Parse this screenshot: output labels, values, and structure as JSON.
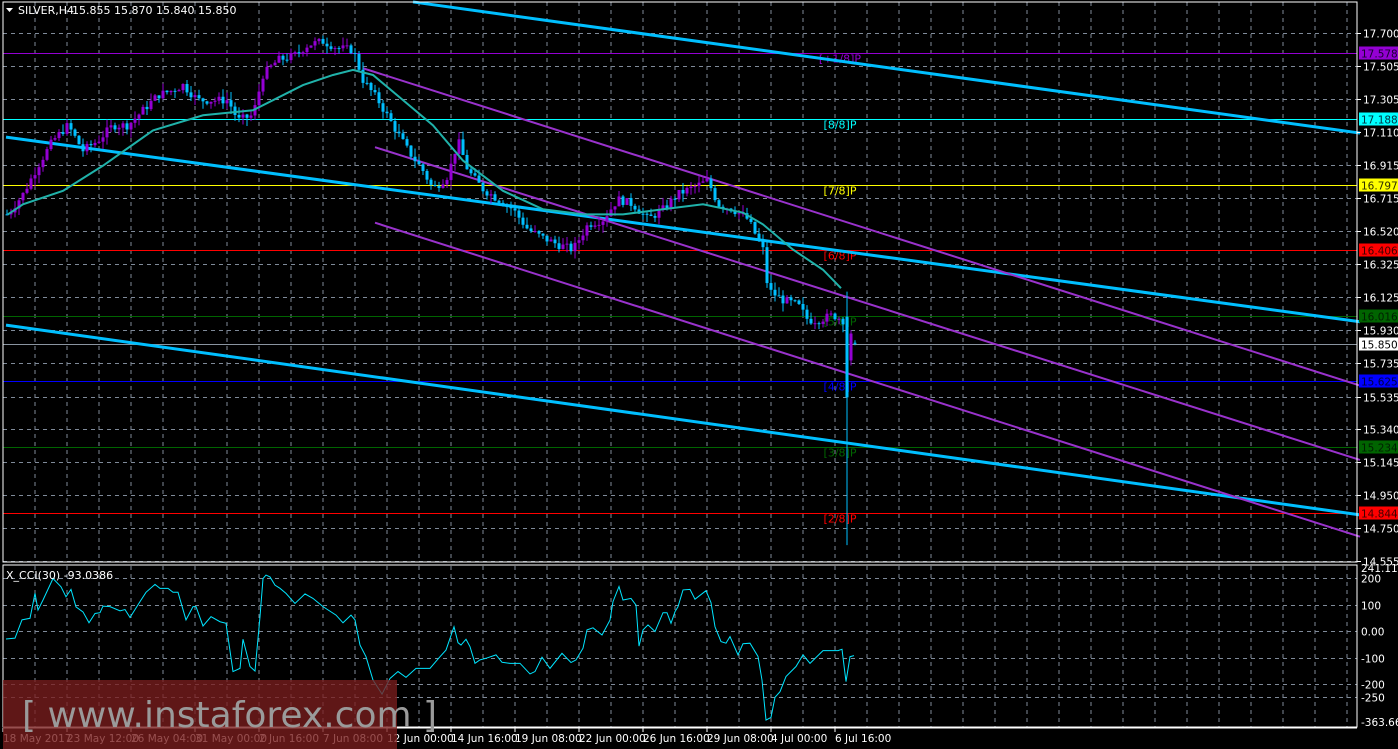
{
  "header": {
    "menu_icon": "triangle-down-icon",
    "symbol": "SILVER,H4",
    "ohlc": "15.855 15.870 15.840 15.850"
  },
  "indicator": {
    "label": "X_CCI(30) -93.0386"
  },
  "watermark": "[ www.instaforex.com ]",
  "colors": {
    "background": "#000000",
    "grid": "#7f8a99",
    "bull": "#9400D3",
    "bear": "#00BFFF",
    "ma": "#20B2AA",
    "trend": "#00BFFF",
    "channel": "#9932CC",
    "cci": "#00E5FF"
  },
  "chart_data": [
    {
      "type": "candlestick",
      "title": "SILVER,H4",
      "yaxis_ticks": [
        "17.700",
        "17.505",
        "17.305",
        "17.110",
        "16.915",
        "16.715",
        "16.520",
        "16.325",
        "16.125",
        "15.930",
        "15.735",
        "15.535",
        "15.340",
        "15.145",
        "14.950",
        "14.750",
        "14.555"
      ],
      "ylim": [
        14.555,
        17.7
      ],
      "xaxis_labels": [
        "18 May 2017",
        "23 May 12:00",
        "26 May 04:00",
        "31 May 00:00",
        "2 Jun 16:00",
        "7 Jun 08:00",
        "12 Jun 00:00",
        "14 Jun 16:00",
        "19 Jun 08:00",
        "22 Jun 00:00",
        "26 Jun 16:00",
        "29 Jun 08:00",
        "4 Jul 00:00",
        "6 Jul 16:00"
      ],
      "bars_per_label": 16,
      "close_path": [
        [
          1.25,
          16.62
        ],
        [
          5,
          16.74
        ],
        [
          8.75,
          16.91
        ],
        [
          12.5,
          17.06
        ],
        [
          16.25,
          17.15
        ],
        [
          20,
          17.0
        ],
        [
          23.75,
          17.06
        ],
        [
          27.5,
          17.15
        ],
        [
          31.25,
          17.15
        ],
        [
          35,
          17.24
        ],
        [
          38.75,
          17.33
        ],
        [
          42.5,
          17.36
        ],
        [
          45,
          17.39
        ],
        [
          48.75,
          17.3
        ],
        [
          52.5,
          17.3
        ],
        [
          56.25,
          17.3
        ],
        [
          58.75,
          17.18
        ],
        [
          62.5,
          17.21
        ],
        [
          65,
          17.45
        ],
        [
          68.75,
          17.54
        ],
        [
          72.5,
          17.56
        ],
        [
          76.25,
          17.63
        ],
        [
          80,
          17.65
        ],
        [
          83.75,
          17.61
        ],
        [
          87.5,
          17.6
        ],
        [
          90,
          17.42
        ],
        [
          93.75,
          17.3
        ],
        [
          97.5,
          17.15
        ],
        [
          101.25,
          17.0
        ],
        [
          105,
          16.88
        ],
        [
          107.5,
          16.77
        ],
        [
          111.25,
          16.85
        ],
        [
          113.75,
          17.06
        ],
        [
          116.25,
          16.88
        ],
        [
          120,
          16.77
        ],
        [
          123.75,
          16.71
        ],
        [
          127.5,
          16.65
        ],
        [
          131.25,
          16.53
        ],
        [
          135,
          16.48
        ],
        [
          138.75,
          16.44
        ],
        [
          142.5,
          16.41
        ],
        [
          146.25,
          16.56
        ],
        [
          150,
          16.59
        ],
        [
          153.75,
          16.71
        ],
        [
          157.5,
          16.68
        ],
        [
          161.25,
          16.59
        ],
        [
          165,
          16.65
        ],
        [
          168.75,
          16.74
        ],
        [
          172.5,
          16.78
        ],
        [
          176.25,
          16.82
        ],
        [
          178.75,
          16.68
        ],
        [
          182.5,
          16.65
        ],
        [
          186.25,
          16.59
        ],
        [
          190,
          16.41
        ],
        [
          191.25,
          16.17
        ],
        [
          195,
          16.11
        ],
        [
          198.75,
          16.08
        ],
        [
          201.25,
          15.99
        ],
        [
          203.75,
          15.99
        ],
        [
          207.5,
          16.02
        ],
        [
          210,
          15.99
        ]
      ],
      "last_candles": [
        {
          "bar": 211,
          "o": 16.01,
          "h": 16.16,
          "l": 14.65,
          "c": 15.53
        },
        {
          "bar": 212,
          "o": 15.75,
          "h": 15.93,
          "l": 15.72,
          "c": 15.91
        },
        {
          "bar": 213,
          "o": 15.855,
          "h": 15.87,
          "l": 15.84,
          "c": 15.85
        }
      ],
      "moving_average": [
        [
          1.25,
          16.62
        ],
        [
          5,
          16.68
        ],
        [
          15,
          16.76
        ],
        [
          25,
          16.91
        ],
        [
          37.5,
          17.12
        ],
        [
          50,
          17.21
        ],
        [
          62.5,
          17.24
        ],
        [
          75,
          17.39
        ],
        [
          82.5,
          17.45
        ],
        [
          87.5,
          17.48
        ],
        [
          92.5,
          17.45
        ],
        [
          100,
          17.3
        ],
        [
          107.5,
          17.15
        ],
        [
          115,
          16.94
        ],
        [
          125,
          16.76
        ],
        [
          135,
          16.65
        ],
        [
          145,
          16.62
        ],
        [
          155,
          16.62
        ],
        [
          165,
          16.65
        ],
        [
          175,
          16.68
        ],
        [
          185,
          16.63
        ],
        [
          190,
          16.56
        ],
        [
          197.5,
          16.41
        ],
        [
          205,
          16.29
        ],
        [
          209.5,
          16.18
        ]
      ],
      "trendlines": [
        {
          "kind": "trend",
          "from": [
            102.5,
            17.885
          ],
          "to": [
            339.25,
            17.104
          ]
        },
        {
          "kind": "trend",
          "from": [
            0.75,
            17.08
          ],
          "to": [
            339.25,
            15.98
          ]
        },
        {
          "kind": "trend",
          "from": [
            0.75,
            15.96
          ],
          "to": [
            339.25,
            14.83
          ]
        },
        {
          "kind": "channel",
          "from": [
            90,
            17.49
          ],
          "to": [
            339.25,
            15.6
          ]
        },
        {
          "kind": "channel",
          "from": [
            93,
            17.02
          ],
          "to": [
            339.25,
            15.157
          ]
        },
        {
          "kind": "channel",
          "from": [
            93,
            16.57
          ],
          "to": [
            339.25,
            14.7
          ]
        }
      ],
      "levels": [
        {
          "price": 17.578,
          "value": "17.578",
          "label": "[+1/8]P",
          "color": "#9400D3",
          "text": "#1a0030"
        },
        {
          "price": 17.188,
          "value": "17.188",
          "label": "[8/8]P",
          "color": "#00FFFF",
          "text": "#003040"
        },
        {
          "price": 16.797,
          "value": "16.797",
          "label": "[7/8]P",
          "color": "#FFFF00",
          "text": "#303000"
        },
        {
          "price": 16.406,
          "value": "16.406",
          "label": "[6/8]P",
          "color": "#FF0000",
          "text": "#400000"
        },
        {
          "price": 16.016,
          "value": "16.016",
          "label": "[5/8]P",
          "color": "#006400",
          "text": "#002000"
        },
        {
          "price": 15.625,
          "value": "15.625",
          "label": "[4/8]P",
          "color": "#0000FF",
          "text": "#000040"
        },
        {
          "price": 15.234,
          "value": "15.234",
          "label": "[3/8]P",
          "color": "#006400",
          "text": "#002000"
        },
        {
          "price": 14.844,
          "value": "14.844",
          "label": "[2/8]P",
          "color": "#FF0000",
          "text": "#400000"
        }
      ],
      "current_price": {
        "price": 15.85,
        "value": "15.850"
      }
    },
    {
      "type": "line",
      "title": "X_CCI(30)",
      "ylim": [
        -363.663,
        241.1164
      ],
      "yaxis_ticks": [
        "241.1164",
        "200",
        "100",
        "0.00",
        "-100",
        "-200",
        "-250",
        "-363.663"
      ],
      "ytick_values": [
        241.1164,
        200,
        100,
        0,
        -100,
        -200,
        -250,
        -363.663
      ],
      "series": [
        [
          0.75,
          -30
        ],
        [
          3,
          -27
        ],
        [
          4.75,
          42
        ],
        [
          6.75,
          48
        ],
        [
          8,
          142
        ],
        [
          8.75,
          79
        ],
        [
          10,
          117
        ],
        [
          12.5,
          198
        ],
        [
          14.5,
          167
        ],
        [
          15.75,
          129
        ],
        [
          17,
          157
        ],
        [
          18.25,
          91
        ],
        [
          20,
          72
        ],
        [
          21.5,
          31
        ],
        [
          23,
          66
        ],
        [
          24.25,
          69
        ],
        [
          25,
          94
        ],
        [
          26.75,
          92
        ],
        [
          29.25,
          76
        ],
        [
          30.5,
          81
        ],
        [
          31.75,
          51
        ],
        [
          34.25,
          111
        ],
        [
          35.75,
          146
        ],
        [
          38,
          176
        ],
        [
          39.25,
          161
        ],
        [
          41.25,
          161
        ],
        [
          42.5,
          146
        ],
        [
          43.75,
          146
        ],
        [
          45.75,
          42
        ],
        [
          47.5,
          92
        ],
        [
          48.25,
          92
        ],
        [
          50,
          19
        ],
        [
          52,
          54
        ],
        [
          54.25,
          35
        ],
        [
          55.75,
          29
        ],
        [
          57.5,
          -153
        ],
        [
          59.25,
          -141
        ],
        [
          60,
          -31
        ],
        [
          61.75,
          -134
        ],
        [
          63,
          -151
        ],
        [
          64.25,
          54
        ],
        [
          65,
          198
        ],
        [
          65.75,
          211
        ],
        [
          66.75,
          204
        ],
        [
          68,
          173
        ],
        [
          69.25,
          161
        ],
        [
          70.75,
          142
        ],
        [
          73,
          104
        ],
        [
          75.5,
          140
        ],
        [
          77.5,
          123
        ],
        [
          80,
          92
        ],
        [
          83.25,
          60
        ],
        [
          85,
          31
        ],
        [
          87,
          60
        ],
        [
          88,
          42
        ],
        [
          89.25,
          -53
        ],
        [
          90.75,
          -97
        ],
        [
          92.5,
          -185
        ],
        [
          94.75,
          -238
        ],
        [
          96.75,
          -179
        ],
        [
          98.75,
          -153
        ],
        [
          100.75,
          -175
        ],
        [
          103.25,
          -141
        ],
        [
          106.75,
          -141
        ],
        [
          109.25,
          -97
        ],
        [
          110.75,
          -72
        ],
        [
          112.75,
          16
        ],
        [
          113.75,
          -44
        ],
        [
          114.5,
          -53
        ],
        [
          115.75,
          -31
        ],
        [
          116.75,
          -59
        ],
        [
          118,
          -122
        ],
        [
          119.25,
          -109
        ],
        [
          120.75,
          -103
        ],
        [
          123.25,
          -90
        ],
        [
          124.75,
          -118
        ],
        [
          126.75,
          -122
        ],
        [
          129.25,
          -122
        ],
        [
          131.75,
          -162
        ],
        [
          133,
          -153
        ],
        [
          134.75,
          -99
        ],
        [
          136.75,
          -141
        ],
        [
          139.75,
          -84
        ],
        [
          142,
          -119
        ],
        [
          143.25,
          -109
        ],
        [
          145,
          -65
        ],
        [
          146,
          4
        ],
        [
          147.5,
          12
        ],
        [
          149.75,
          -15
        ],
        [
          151.75,
          41
        ],
        [
          152.5,
          111
        ],
        [
          154,
          168
        ],
        [
          155,
          117
        ],
        [
          157,
          123
        ],
        [
          158.25,
          98
        ],
        [
          159,
          -57
        ],
        [
          160,
          4
        ],
        [
          161.25,
          23
        ],
        [
          163,
          -2
        ],
        [
          165,
          69
        ],
        [
          166,
          69
        ],
        [
          167,
          29
        ],
        [
          168,
          73
        ],
        [
          168.75,
          92
        ],
        [
          170,
          155
        ],
        [
          171.75,
          157
        ],
        [
          173,
          120
        ],
        [
          175.75,
          152
        ],
        [
          177,
          107
        ],
        [
          178,
          16
        ],
        [
          179.5,
          -40
        ],
        [
          180.75,
          -46
        ],
        [
          181.75,
          -21
        ],
        [
          183.75,
          -90
        ],
        [
          185,
          -48
        ],
        [
          186.75,
          -46
        ],
        [
          188.75,
          -96
        ],
        [
          189.75,
          -185
        ],
        [
          190.75,
          -336
        ],
        [
          192,
          -326
        ],
        [
          193,
          -250
        ],
        [
          194.25,
          -229
        ],
        [
          195.75,
          -172
        ],
        [
          198.25,
          -134
        ],
        [
          200,
          -90
        ],
        [
          201.75,
          -122
        ],
        [
          205,
          -74
        ],
        [
          208.75,
          -74
        ],
        [
          209.75,
          -69
        ],
        [
          210.75,
          -191
        ],
        [
          211.75,
          -97
        ],
        [
          212.75,
          -93
        ]
      ]
    }
  ]
}
